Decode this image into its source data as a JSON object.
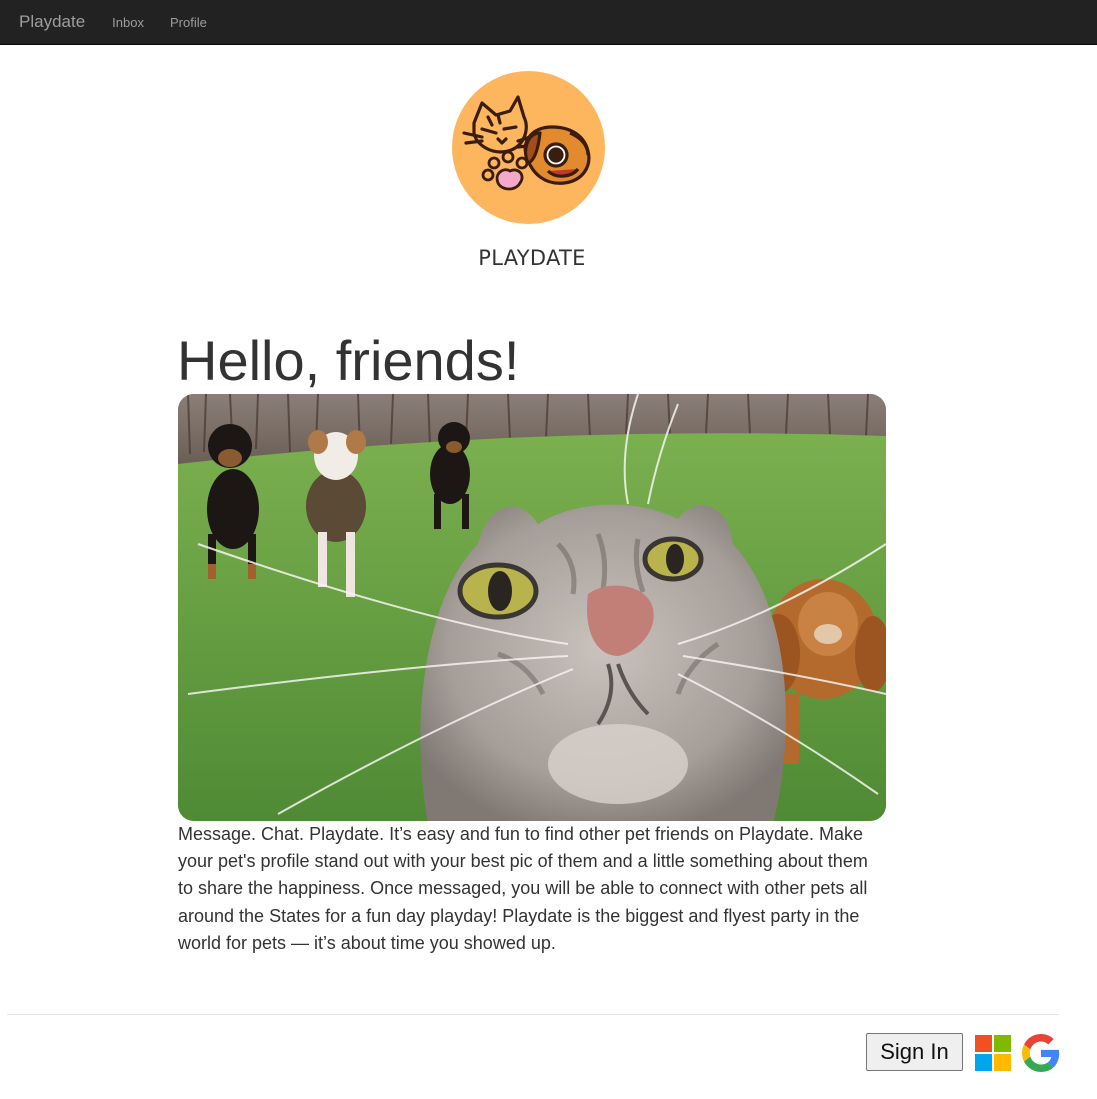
{
  "nav": {
    "brand": "Playdate",
    "links": [
      {
        "label": "Inbox"
      },
      {
        "label": "Profile"
      }
    ]
  },
  "header": {
    "logo_icon": "cat-dog-paw-logo",
    "site_name": "PLAYDATE"
  },
  "main": {
    "headline": "Hello, friends!",
    "hero_image": "cat-selfie-with-dogs-photo",
    "intro": "Message. Chat. Playdate. It’s easy and fun to find other pet friends on Playdate. Make your pet's profile stand out with your best pic of them and a little something about them to share the happiness. Once messaged, you will be able to connect with other pets all around the States for a fun day playday! Playdate is the biggest and flyest party in the world for pets — it’s about time you showed up."
  },
  "footer": {
    "sign_in_label": "Sign In",
    "providers": [
      {
        "name": "microsoft-logo"
      },
      {
        "name": "google-logo"
      }
    ]
  },
  "colors": {
    "navbar": "#222222",
    "nav_text": "#9d9d9d",
    "logo_bg": "#fdb55e",
    "text": "#333333"
  }
}
